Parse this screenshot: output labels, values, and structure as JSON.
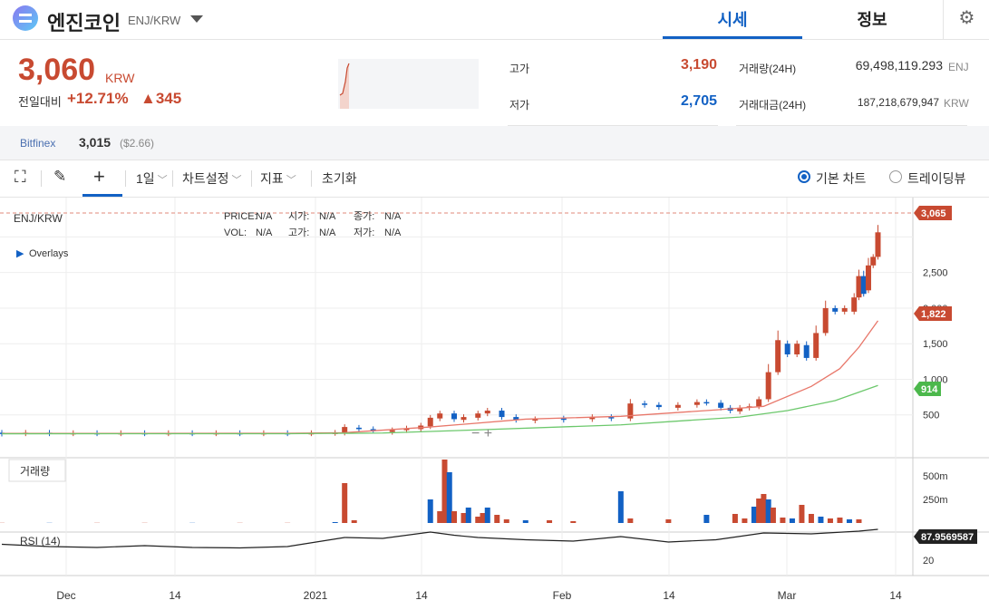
{
  "header": {
    "coin_name": "엔진코인",
    "pair": "ENJ/KRW",
    "tab_sise": "시세",
    "tab_info": "정보",
    "gear_icon": "gear-icon"
  },
  "price": {
    "current": "3,060",
    "currency": "KRW",
    "change_label": "전일대비",
    "change_pct": "+12.71%",
    "change_abs": "▲345"
  },
  "stats": {
    "high_label": "고가",
    "high": "3,190",
    "low_label": "저가",
    "low": "2,705",
    "volume_label": "거래량(24H)",
    "volume": "69,498,119.293",
    "volume_unit": "ENJ",
    "amount_label": "거래대금(24H)",
    "amount": "187,218,679,947",
    "amount_unit": "KRW"
  },
  "bitfinex": {
    "name": "Bitfinex",
    "price": "3,015",
    "usd": "($2.66)"
  },
  "toolbar": {
    "interval": "1일",
    "chart_settings": "차트설정",
    "indicators": "지표",
    "reset": "초기화",
    "basic_chart": "기본 차트",
    "tradingview": "트레이딩뷰"
  },
  "legend": {
    "symbol": "ENJ/KRW",
    "overlays": "Overlays",
    "price_label": "PRICE:",
    "price": "N/A",
    "open_label": "시가:",
    "open": "N/A",
    "close_label": "종가:",
    "close": "N/A",
    "vol_label": "VOL:",
    "vol": "N/A",
    "high_label": "고가:",
    "high": "N/A",
    "low_label": "저가:",
    "low": "N/A",
    "volume_panel": "거래량",
    "rsi_panel": "RSI (14)"
  },
  "colors": {
    "up": "#c84a31",
    "down": "#1261c4",
    "ma_short": "#e8776a",
    "ma_long": "#6cc86c"
  },
  "chart_data": {
    "type": "candlestick",
    "xlabels": [
      "Dec",
      "14",
      "2021",
      "14",
      "Feb",
      "14",
      "Mar",
      "14"
    ],
    "yticks": [
      500,
      1000,
      1500,
      2000,
      2500,
      3000
    ],
    "ytick_labels": [
      "500",
      "1,000",
      "1,500",
      "2,000",
      "2,500",
      ""
    ],
    "ylim": [
      0,
      3400
    ],
    "last_price_tag": "3,065",
    "ma_short_tag": "1,822",
    "ma_long_tag": "914",
    "volume_ticks": [
      "500m",
      "250m"
    ],
    "volume_ylim": [
      0,
      700
    ],
    "rsi_tag": "87.9569587",
    "rsi_tick": "20",
    "rsi_ylim": [
      0,
      100
    ],
    "candles": [
      {
        "i": 0,
        "o": 250,
        "c": 235
      },
      {
        "i": 5,
        "o": 240,
        "c": 250
      },
      {
        "i": 10,
        "o": 250,
        "c": 240
      },
      {
        "i": 15,
        "o": 240,
        "c": 245
      },
      {
        "i": 20,
        "o": 245,
        "c": 240
      },
      {
        "i": 25,
        "o": 240,
        "c": 245
      },
      {
        "i": 30,
        "o": 245,
        "c": 240
      },
      {
        "i": 35,
        "o": 240,
        "c": 245
      },
      {
        "i": 40,
        "o": 245,
        "c": 240
      },
      {
        "i": 45,
        "o": 240,
        "c": 245
      },
      {
        "i": 50,
        "o": 245,
        "c": 240
      },
      {
        "i": 55,
        "o": 240,
        "c": 245
      },
      {
        "i": 60,
        "o": 245,
        "c": 240
      },
      {
        "i": 65,
        "o": 240,
        "c": 245
      },
      {
        "i": 70,
        "o": 245,
        "c": 250
      },
      {
        "i": 72,
        "o": 250,
        "c": 330
      },
      {
        "i": 75,
        "o": 320,
        "c": 300
      },
      {
        "i": 78,
        "o": 300,
        "c": 290
      },
      {
        "i": 82,
        "o": 260,
        "c": 285
      },
      {
        "i": 85,
        "o": 285,
        "c": 310
      },
      {
        "i": 88,
        "o": 300,
        "c": 350
      },
      {
        "i": 90,
        "o": 340,
        "c": 460
      },
      {
        "i": 92,
        "o": 450,
        "c": 520
      },
      {
        "i": 95,
        "o": 520,
        "c": 440
      },
      {
        "i": 97,
        "o": 430,
        "c": 470
      },
      {
        "i": 100,
        "o": 460,
        "c": 520
      },
      {
        "i": 102,
        "o": 520,
        "c": 560
      },
      {
        "i": 105,
        "o": 560,
        "c": 470
      },
      {
        "i": 108,
        "o": 470,
        "c": 430
      },
      {
        "i": 112,
        "o": 420,
        "c": 440
      },
      {
        "i": 118,
        "o": 450,
        "c": 430
      },
      {
        "i": 124,
        "o": 440,
        "c": 470
      },
      {
        "i": 128,
        "o": 470,
        "c": 450
      },
      {
        "i": 132,
        "o": 450,
        "c": 660
      },
      {
        "i": 135,
        "o": 660,
        "c": 640
      },
      {
        "i": 138,
        "o": 640,
        "c": 610
      },
      {
        "i": 142,
        "o": 600,
        "c": 640
      },
      {
        "i": 146,
        "o": 640,
        "c": 680
      },
      {
        "i": 148,
        "o": 680,
        "c": 670
      },
      {
        "i": 151,
        "o": 670,
        "c": 600
      },
      {
        "i": 153,
        "o": 600,
        "c": 560
      },
      {
        "i": 155,
        "o": 550,
        "c": 600
      },
      {
        "i": 157,
        "o": 600,
        "c": 620
      },
      {
        "i": 159,
        "o": 620,
        "c": 720
      },
      {
        "i": 161,
        "o": 720,
        "c": 1100
      },
      {
        "i": 163,
        "o": 1100,
        "c": 1550
      },
      {
        "i": 165,
        "o": 1500,
        "c": 1350
      },
      {
        "i": 167,
        "o": 1350,
        "c": 1500
      },
      {
        "i": 169,
        "o": 1480,
        "c": 1300
      },
      {
        "i": 171,
        "o": 1300,
        "c": 1650
      },
      {
        "i": 173,
        "o": 1650,
        "c": 2000
      },
      {
        "i": 175,
        "o": 2000,
        "c": 1950
      },
      {
        "i": 177,
        "o": 1950,
        "c": 2000
      },
      {
        "i": 179,
        "o": 1950,
        "c": 2150
      },
      {
        "i": 180,
        "o": 2150,
        "c": 2450
      },
      {
        "i": 181,
        "o": 2450,
        "c": 2200
      },
      {
        "i": 182,
        "o": 2250,
        "c": 2600
      },
      {
        "i": 183,
        "o": 2600,
        "c": 2720
      },
      {
        "i": 184,
        "o": 2720,
        "c": 3065
      }
    ],
    "ma_short": [
      [
        0,
        240
      ],
      [
        60,
        242
      ],
      [
        72,
        250
      ],
      [
        90,
        330
      ],
      [
        110,
        440
      ],
      [
        130,
        480
      ],
      [
        150,
        570
      ],
      [
        160,
        620
      ],
      [
        170,
        900
      ],
      [
        176,
        1150
      ],
      [
        180,
        1450
      ],
      [
        184,
        1822
      ]
    ],
    "ma_long": [
      [
        0,
        235
      ],
      [
        60,
        236
      ],
      [
        80,
        245
      ],
      [
        100,
        290
      ],
      [
        130,
        360
      ],
      [
        155,
        470
      ],
      [
        165,
        560
      ],
      [
        175,
        700
      ],
      [
        184,
        914
      ]
    ],
    "volume": [
      [
        0,
        2
      ],
      [
        10,
        2
      ],
      [
        20,
        2
      ],
      [
        30,
        2
      ],
      [
        40,
        2
      ],
      [
        50,
        2
      ],
      [
        60,
        2
      ],
      [
        70,
        10
      ],
      [
        72,
        440
      ],
      [
        74,
        30
      ],
      [
        90,
        260
      ],
      [
        92,
        130
      ],
      [
        93,
        700
      ],
      [
        94,
        560
      ],
      [
        95,
        130
      ],
      [
        97,
        110
      ],
      [
        98,
        170
      ],
      [
        100,
        70
      ],
      [
        101,
        110
      ],
      [
        102,
        170
      ],
      [
        104,
        90
      ],
      [
        106,
        40
      ],
      [
        110,
        30
      ],
      [
        115,
        30
      ],
      [
        120,
        20
      ],
      [
        130,
        350
      ],
      [
        132,
        50
      ],
      [
        140,
        40
      ],
      [
        148,
        90
      ],
      [
        154,
        100
      ],
      [
        156,
        50
      ],
      [
        158,
        180
      ],
      [
        159,
        270
      ],
      [
        160,
        320
      ],
      [
        161,
        260
      ],
      [
        162,
        170
      ],
      [
        164,
        60
      ],
      [
        166,
        50
      ],
      [
        168,
        200
      ],
      [
        170,
        100
      ],
      [
        172,
        70
      ],
      [
        174,
        50
      ],
      [
        176,
        60
      ],
      [
        178,
        40
      ],
      [
        180,
        40
      ]
    ],
    "rsi": [
      [
        0,
        55
      ],
      [
        10,
        50
      ],
      [
        20,
        48
      ],
      [
        30,
        52
      ],
      [
        40,
        48
      ],
      [
        50,
        47
      ],
      [
        60,
        50
      ],
      [
        72,
        70
      ],
      [
        80,
        68
      ],
      [
        90,
        82
      ],
      [
        95,
        75
      ],
      [
        100,
        70
      ],
      [
        110,
        65
      ],
      [
        120,
        62
      ],
      [
        130,
        72
      ],
      [
        140,
        60
      ],
      [
        150,
        65
      ],
      [
        160,
        80
      ],
      [
        170,
        78
      ],
      [
        180,
        84
      ],
      [
        184,
        87.96
      ]
    ]
  }
}
